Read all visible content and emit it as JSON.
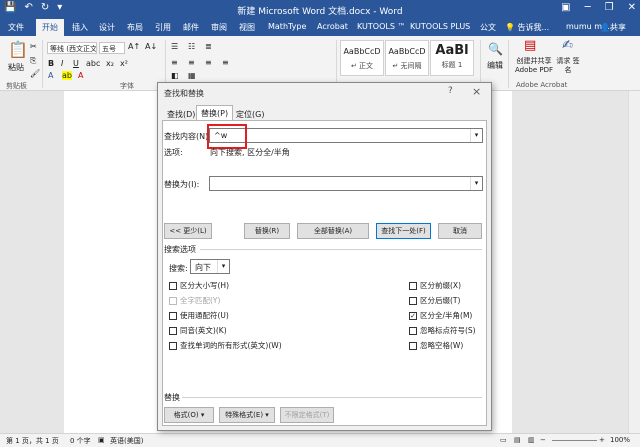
{
  "window": {
    "title": "新建 Microsoft Word 文档.docx - Word"
  },
  "menu_tabs": [
    "文件",
    "开始",
    "插入",
    "设计",
    "布局",
    "引用",
    "邮件",
    "审阅",
    "视图",
    "MathType",
    "Acrobat",
    "KUTOOLS ™",
    "KUTOOLS PLUS",
    "公文"
  ],
  "menu_right": {
    "tell_me": "告诉我...",
    "user": "mumu mu...",
    "share": "共享"
  },
  "ribbon": {
    "paste": "粘贴",
    "clipboard": "剪贴板",
    "font_name": "等线 (西文正文)",
    "font_size": "五号",
    "font_group": "字体",
    "style_cards": [
      {
        "preview": "AaBbCcD",
        "name": "正文"
      },
      {
        "preview": "AaBbCcD",
        "name": "无间隔"
      },
      {
        "preview": "AaBl",
        "name": "标题 1"
      }
    ],
    "edit": "编辑",
    "create_share_pdf": "创建并共享 Adobe PDF",
    "request_sign": "请求 签名",
    "acrobat_group": "Adobe Acrobat"
  },
  "dialog": {
    "title": "查找和替换",
    "help": "?",
    "close": "×",
    "tabs": [
      "查找(D)",
      "替换(P)",
      "定位(G)"
    ],
    "find_label": "查找内容(N):",
    "find_value": "^w",
    "options_label": "选项:",
    "options_value": "向下搜索, 区分全/半角",
    "replace_label": "替换为(I):",
    "replace_value": "",
    "buttons": {
      "less": "<< 更少(L)",
      "replace": "替换(R)",
      "replace_all": "全部替换(A)",
      "find_next": "查找下一处(F)",
      "cancel": "取消"
    },
    "search_options_title": "搜索选项",
    "search_label": "搜索:",
    "search_value": "向下",
    "left_checks": [
      {
        "label": "区分大小写(H)",
        "checked": false,
        "enabled": true
      },
      {
        "label": "全字匹配(Y)",
        "checked": false,
        "enabled": false
      },
      {
        "label": "使用通配符(U)",
        "checked": false,
        "enabled": true
      },
      {
        "label": "同音(英文)(K)",
        "checked": false,
        "enabled": true
      },
      {
        "label": "查找单词的所有形式(英文)(W)",
        "checked": false,
        "enabled": true
      }
    ],
    "right_checks": [
      {
        "label": "区分前缀(X)",
        "checked": false,
        "enabled": true
      },
      {
        "label": "区分后缀(T)",
        "checked": false,
        "enabled": true
      },
      {
        "label": "区分全/半角(M)",
        "checked": true,
        "enabled": true
      },
      {
        "label": "忽略标点符号(S)",
        "checked": false,
        "enabled": true
      },
      {
        "label": "忽略空格(W)",
        "checked": false,
        "enabled": true
      }
    ],
    "replace_section": "替换",
    "bottom_buttons": {
      "format": "格式(O) ▾",
      "special": "特殊格式(E) ▾",
      "no_format": "不限定格式(T)"
    }
  },
  "status": {
    "page": "第 1 页，共 1 页",
    "words": "0 个字",
    "lang": "英语(美国)",
    "zoom": "100%"
  }
}
